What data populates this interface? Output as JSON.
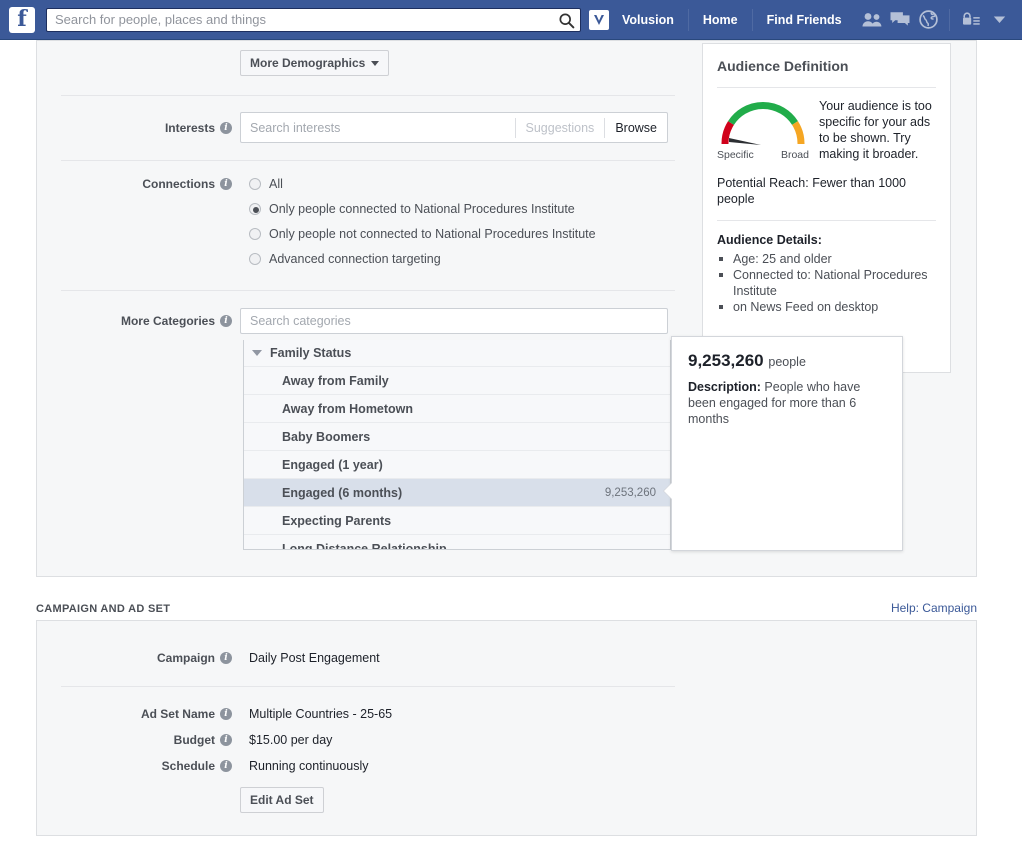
{
  "topbar": {
    "logo_icon": "facebook-logo-icon",
    "search": {
      "placeholder": "Search for people, places and things",
      "value": "",
      "icon": "search-icon"
    },
    "brand": {
      "label": "Volusion",
      "mark_icon": "volusion-logo-icon"
    },
    "links": [
      {
        "label": "Home",
        "name": "home"
      },
      {
        "label": "Find Friends",
        "name": "find-friends"
      }
    ],
    "icons": [
      {
        "name": "friend-requests-icon"
      },
      {
        "name": "messages-icon"
      },
      {
        "name": "notifications-globe-icon"
      },
      {
        "name": "privacy-lock-icon"
      },
      {
        "name": "account-chevron-down-icon"
      }
    ]
  },
  "targeting": {
    "more_demographics_button": "More Demographics",
    "interests": {
      "label": "Interests",
      "placeholder": "Search interests",
      "value": "",
      "suggestions_label": "Suggestions",
      "browse_label": "Browse"
    },
    "connections": {
      "label": "Connections",
      "options": [
        {
          "label": "All",
          "selected": false
        },
        {
          "label": "Only people connected to National Procedures Institute",
          "selected": true
        },
        {
          "label": "Only people not connected to National Procedures Institute",
          "selected": false
        },
        {
          "label": "Advanced connection targeting",
          "selected": false
        }
      ]
    },
    "more_categories": {
      "label": "More Categories",
      "placeholder": "Search categories",
      "value": "",
      "group_label": "Family Status",
      "items": [
        {
          "label": "Away from Family",
          "count": "",
          "selected": false
        },
        {
          "label": "Away from Hometown",
          "count": "",
          "selected": false
        },
        {
          "label": "Baby Boomers",
          "count": "",
          "selected": false
        },
        {
          "label": "Engaged (1 year)",
          "count": "",
          "selected": false
        },
        {
          "label": "Engaged (6 months)",
          "count": "9,253,260",
          "selected": true
        },
        {
          "label": "Expecting Parents",
          "count": "",
          "selected": false
        },
        {
          "label": "Long Distance Relationship",
          "count": "",
          "selected": false
        }
      ]
    }
  },
  "audience": {
    "title": "Audience Definition",
    "gauge": {
      "left_label": "Specific",
      "right_label": "Broad",
      "colors": {
        "specific": "#d0021b",
        "mid": "#21ac4a",
        "broad": "#f5a623"
      }
    },
    "message": "Your audience is too specific for your ads to be shown. Try making it broader.",
    "reach": "Potential Reach: Fewer than 1000 people",
    "details_title": "Audience Details:",
    "details": [
      "Age: 25 and older",
      "Connected to: National Procedures Institute",
      "on News Feed on desktop"
    ]
  },
  "tooltip": {
    "count": "9,253,260",
    "unit": "people",
    "description_label": "Description:",
    "description": "People who have been engaged for more than 6 months"
  },
  "campaign_section": {
    "heading": "CAMPAIGN AND AD SET",
    "help_link": "Help: Campaign",
    "rows": [
      {
        "label": "Campaign",
        "value": "Daily Post Engagement"
      },
      {
        "label": "Ad Set Name",
        "value": "Multiple Countries - 25-65"
      },
      {
        "label": "Budget",
        "value": "$15.00 per day"
      },
      {
        "label": "Schedule",
        "value": "Running continuously"
      }
    ],
    "edit_button": "Edit Ad Set"
  }
}
